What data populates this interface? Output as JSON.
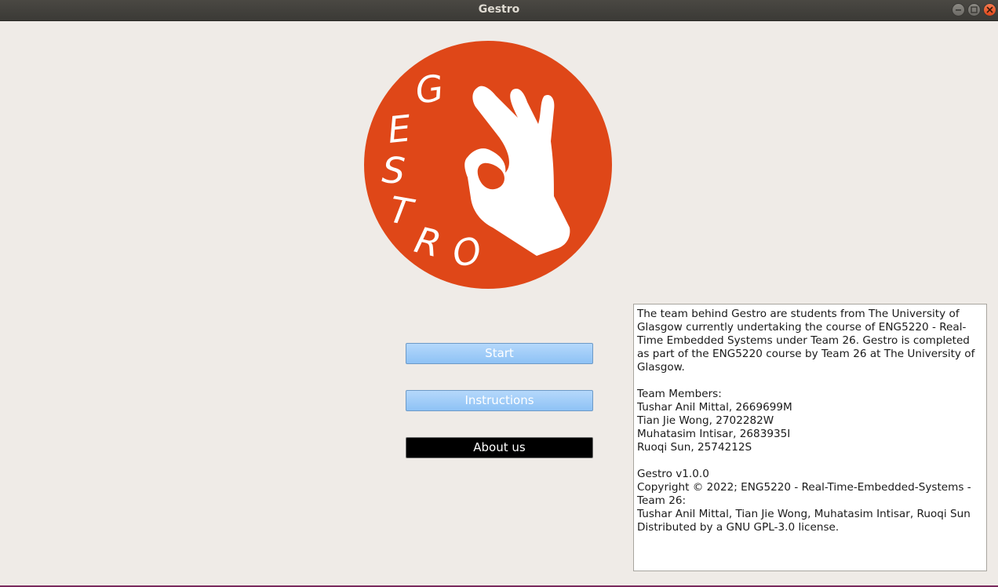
{
  "window": {
    "title": "Gestro"
  },
  "logo": {
    "letters": [
      "G",
      "E",
      "S",
      "T",
      "R",
      "O"
    ],
    "color": "#df4718"
  },
  "buttons": {
    "start": "Start",
    "instructions": "Instructions",
    "about": "About us"
  },
  "about": {
    "paragraph1": "The team behind Gestro are students from The University of Glasgow currently undertaking the course of ENG5220 - Real-Time Embedded Systems under Team 26. Gestro is completed as part of the ENG5220 course by Team 26 at The University of Glasgow.",
    "members_heading": "Team Members:",
    "members": [
      "Tushar Anil Mittal, 2669699M",
      "Tian Jie Wong, 2702282W",
      "Muhatasim Intisar, 2683935I",
      "Ruoqi Sun, 2574212S"
    ],
    "version": "Gestro v1.0.0",
    "copyright": "Copyright © 2022; ENG5220 - Real-Time-Embedded-Systems - Team 26:",
    "authors": "Tushar Anil Mittal, Tian Jie Wong, Muhatasim Intisar, Ruoqi Sun",
    "license": "Distributed by a GNU GPL-3.0 license."
  }
}
